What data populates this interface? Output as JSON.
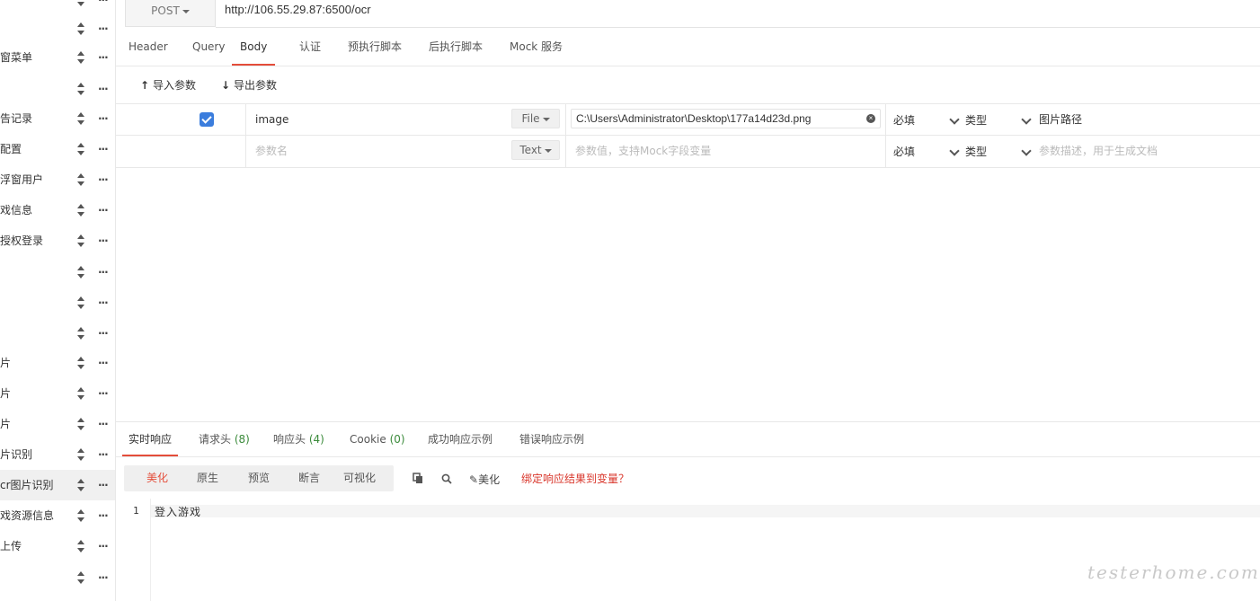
{
  "sidebar": {
    "items": [
      {
        "label": ""
      },
      {
        "label": ""
      },
      {
        "label": "窗菜单"
      },
      {
        "label": ""
      },
      {
        "label": "告记录"
      },
      {
        "label": "配置"
      },
      {
        "label": "浮窗用户"
      },
      {
        "label": "戏信息"
      },
      {
        "label": "授权登录"
      },
      {
        "label": ""
      },
      {
        "label": ""
      },
      {
        "label": ""
      },
      {
        "label": "片"
      },
      {
        "label": "片"
      },
      {
        "label": "片"
      },
      {
        "label": "片识别"
      },
      {
        "label": "cr图片识别"
      },
      {
        "label": "戏资源信息"
      },
      {
        "label": "上传"
      },
      {
        "label": ""
      }
    ]
  },
  "request": {
    "method": "POST",
    "url": "http://106.55.29.87:6500/ocr"
  },
  "top_tabs": [
    "Header",
    "Query",
    "Body",
    "认证",
    "预执行脚本",
    "后执行脚本",
    "Mock 服务"
  ],
  "toolbar": {
    "import_label": "导入参数",
    "export_label": "导出参数"
  },
  "params": {
    "row1": {
      "name": "image",
      "type": "File",
      "value": "C:\\Users\\Administrator\\Desktop\\177a14d23d.png",
      "required": "必填",
      "datatype": "类型",
      "description": "图片路径"
    },
    "row2": {
      "name_placeholder": "参数名",
      "type": "Text",
      "value_placeholder": "参数值，支持Mock字段变量",
      "required": "必填",
      "datatype": "类型",
      "description_placeholder": "参数描述，用于生成文档"
    }
  },
  "response_tabs": {
    "realtime": "实时响应",
    "req_headers": "请求头",
    "req_headers_count": "(8)",
    "resp_headers": "响应头",
    "resp_headers_count": "(4)",
    "cookie": "Cookie",
    "cookie_count": "(0)",
    "success_example": "成功响应示例",
    "error_example": "错误响应示例"
  },
  "view_modes": [
    "美化",
    "原生",
    "预览",
    "断言",
    "可视化"
  ],
  "tools": {
    "beautify": "美化",
    "bind_link": "绑定响应结果到变量？"
  },
  "editor": {
    "line_number": "1",
    "content": "登入游戏"
  },
  "watermark": "testerhome.com",
  "colors": {
    "accent": "#e44d3a",
    "checkbox": "#3b7ddd",
    "count_green": "#3a8a3a"
  }
}
